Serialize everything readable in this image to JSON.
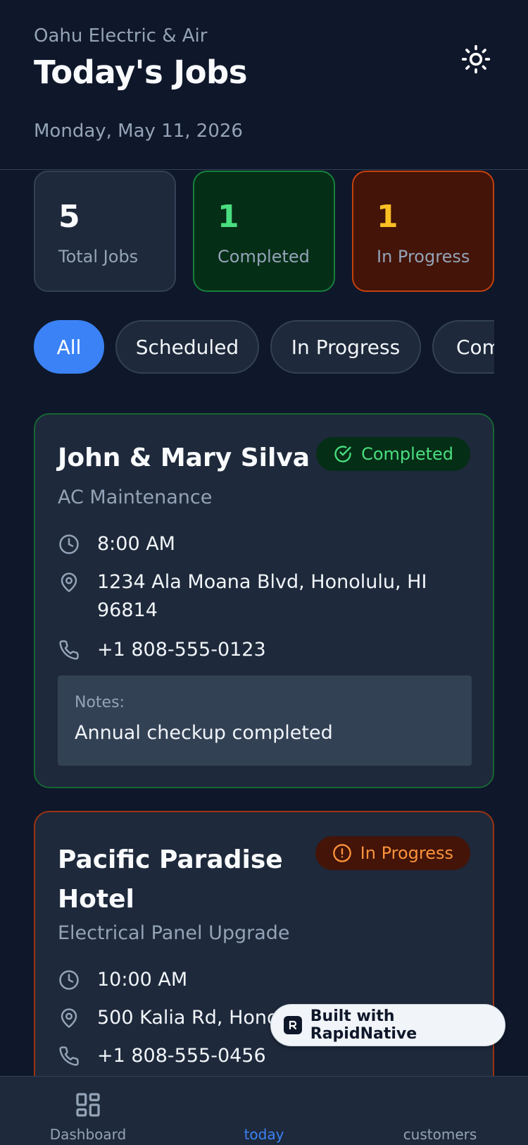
{
  "header": {
    "company": "Oahu Electric & Air",
    "title": "Today's Jobs",
    "date": "Monday, May 11, 2026",
    "theme_icon": "sun-icon"
  },
  "stats": [
    {
      "value": "5",
      "label": "Total Jobs"
    },
    {
      "value": "1",
      "label": "Completed"
    },
    {
      "value": "1",
      "label": "In Progress"
    }
  ],
  "filters": {
    "items": [
      "All",
      "Scheduled",
      "In Progress",
      "Completed"
    ],
    "selected": "All"
  },
  "jobs": [
    {
      "name": "John & Mary Silva",
      "service": "AC Maintenance",
      "status": "Completed",
      "time": "8:00 AM",
      "address": "1234 Ala Moana Blvd, Honolulu, HI 96814",
      "phone": "+1 808-555-0123",
      "notes_label": "Notes:",
      "notes": "Annual checkup completed"
    },
    {
      "name": "Pacific Paradise Hotel",
      "service": "Electrical Panel Upgrade",
      "status": "In Progress",
      "time": "10:00 AM",
      "address": "500 Kalia Rd, Honol",
      "phone": "+1 808-555-0456"
    }
  ],
  "built_with": "Built with RapidNative",
  "tabbar": {
    "items": [
      "Dashboard",
      "today",
      "customers"
    ],
    "active": "today"
  },
  "colors": {
    "background": "#0f172a",
    "accent": "#3b82f6",
    "completed": "#4ade80",
    "in_progress": "#fb923c"
  }
}
